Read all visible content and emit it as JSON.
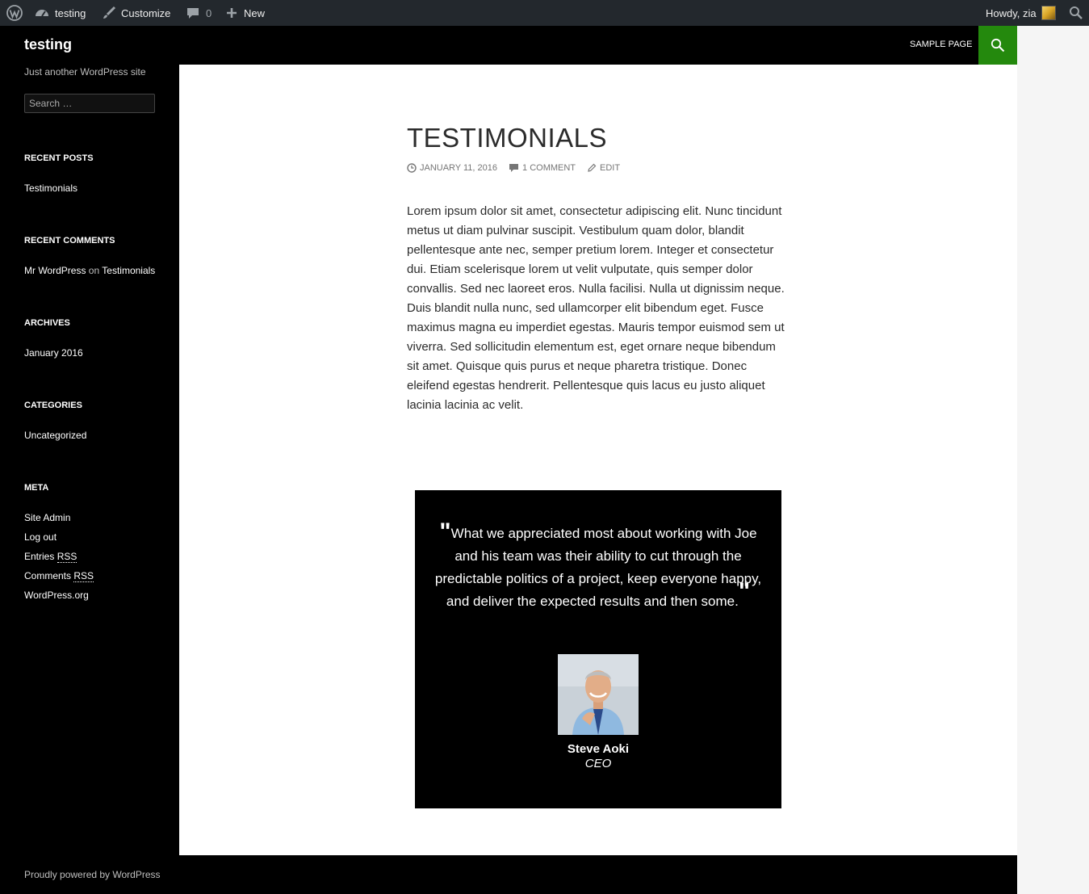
{
  "adminbar": {
    "site_name": "testing",
    "customize": "Customize",
    "comments_count": "0",
    "new_label": "New",
    "howdy": "Howdy, zia"
  },
  "header": {
    "site_title": "testing",
    "nav_sample_page": "SAMPLE PAGE",
    "accent_color": "#24890d"
  },
  "sidebar": {
    "tagline": "Just another WordPress site",
    "search_placeholder": "Search …",
    "recent_posts_title": "RECENT POSTS",
    "recent_posts": [
      "Testimonials"
    ],
    "recent_comments_title": "RECENT COMMENTS",
    "recent_comment": {
      "author": "Mr WordPress",
      "on": "on",
      "post": "Testimonials"
    },
    "archives_title": "ARCHIVES",
    "archives": [
      "January 2016"
    ],
    "categories_title": "CATEGORIES",
    "categories": [
      "Uncategorized"
    ],
    "meta_title": "META",
    "meta_links": {
      "site_admin": "Site Admin",
      "log_out": "Log out",
      "entries": "Entries",
      "comments": "Comments",
      "rss": "RSS",
      "wordpress_org": "WordPress.org"
    }
  },
  "post": {
    "title": "TESTIMONIALS",
    "date": "JANUARY 11, 2016",
    "comments": "1 COMMENT",
    "edit": "EDIT",
    "body": "Lorem ipsum dolor sit amet, consectetur adipiscing elit. Nunc tincidunt metus ut diam pulvinar suscipit. Vestibulum quam dolor, blandit pellentesque ante nec, semper pretium lorem. Integer et consectetur dui. Etiam scelerisque lorem ut velit vulputate, quis semper dolor convallis. Sed nec laoreet eros. Nulla facilisi. Nulla ut dignissim neque. Duis blandit nulla nunc, sed ullamcorper elit bibendum eget. Fusce maximus magna eu imperdiet egestas. Mauris tempor euismod sem ut viverra. Sed sollicitudin elementum est, eget ornare neque bibendum sit amet. Quisque quis purus et neque pharetra tristique. Donec eleifend egestas hendrerit. Pellentesque quis lacus eu justo aliquet lacinia lacinia ac velit."
  },
  "testimonial": {
    "quote": "What we appreciated most about working with Joe and his team was their ability to cut through the predictable politics of a project, keep everyone happy, and deliver the expected results and then some.",
    "open_mark": "\"",
    "close_mark": "\"",
    "name": "Steve Aoki",
    "role": "CEO"
  },
  "footer": {
    "text": "Proudly powered by WordPress"
  }
}
